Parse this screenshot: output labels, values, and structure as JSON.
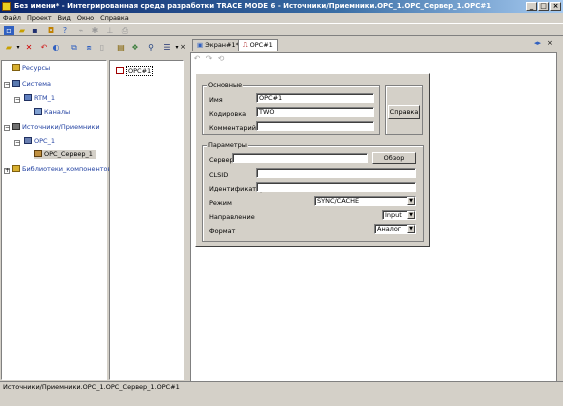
{
  "window": {
    "title": "Без имени* - Интегрированная среда разработки TRACE MODE 6 - Источники/Приемники.OPC_1.OPC_Сервер_1.OPC#1",
    "minimize": "_",
    "maximize": "□",
    "close": "×"
  },
  "menu": [
    "Файл",
    "Проект",
    "Вид",
    "Окно",
    "Справка"
  ],
  "tree": {
    "items": [
      {
        "label": "Ресурсы"
      },
      {
        "label": "Система"
      },
      {
        "label": "RTM_1"
      },
      {
        "label": "Каналы"
      },
      {
        "label": "Источники/Приемники"
      },
      {
        "label": "OPC_1"
      },
      {
        "label": "OPC_Сервер_1"
      },
      {
        "label": "Библиотеки_компонентов"
      }
    ]
  },
  "mid": {
    "item": "OPC#1"
  },
  "tabs": [
    {
      "label": "Экран#1*"
    },
    {
      "label": "OPC#1"
    }
  ],
  "form": {
    "group_basic": "Основные",
    "name_label": "Имя",
    "name_value": "OPC#1",
    "encoding_label": "Кодировка",
    "encoding_value": "TWO",
    "comment_label": "Комментарий",
    "comment_value": "",
    "help_button": "Справка",
    "group_params": "Параметры",
    "server_label": "Сервер",
    "server_value": "",
    "browse_button": "Обзор",
    "clsid_label": "CLSID",
    "clsid_value": "",
    "ident_label": "Идентификатор",
    "ident_value": "",
    "mode_label": "Режим",
    "mode_value": "SYNC/CACHE",
    "direction_label": "Направление",
    "direction_value": "Input",
    "format_label": "Формат",
    "format_value": "Аналог"
  },
  "status": "Источники/Приемники.OPC_1.OPC_Сервер_1.OPC#1",
  "colors": {
    "titlebar": "#0a246a",
    "face": "#d4d0c8",
    "link": "#1f3fa0"
  }
}
